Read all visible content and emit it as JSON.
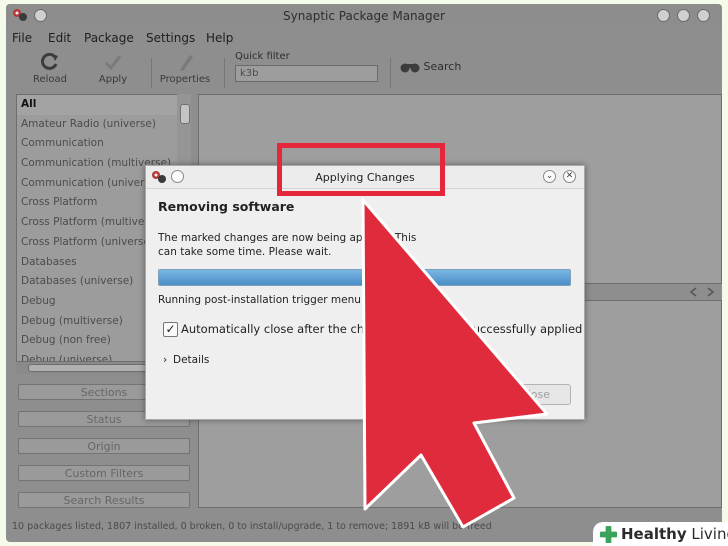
{
  "window": {
    "title": "Synaptic Package Manager"
  },
  "menu": [
    "File",
    "Edit",
    "Package",
    "Settings",
    "Help"
  ],
  "toolbar": {
    "reload": "Reload",
    "apply": "Apply",
    "properties": "Properties",
    "quick_filter_label": "Quick filter",
    "quick_filter_value": "k3b",
    "search": "Search"
  },
  "categories": [
    "All",
    "Amateur Radio (universe)",
    "Communication",
    "Communication (multiverse)",
    "Communication (universe)",
    "Cross Platform",
    "Cross Platform (multiverse)",
    "Cross Platform (universe)",
    "Databases",
    "Databases (universe)",
    "Debug",
    "Debug (multiverse)",
    "Debug (non free)",
    "Debug (universe)"
  ],
  "filter_buttons": [
    "Sections",
    "Status",
    "Origin",
    "Custom Filters",
    "Search Results"
  ],
  "status_bar": "10 packages listed, 1807 installed, 0 broken, 0 to install/upgrade, 1 to remove; 1891 kB will be freed",
  "dialog": {
    "title": "Applying Changes",
    "heading": "Removing software",
    "message": "The marked changes are now being applied. This can take some time. Please wait.",
    "progress": 1.0,
    "status": "Running post-installation trigger menu",
    "auto_close_label": "Automatically close after the changes have been successfully applied",
    "auto_close_checked": true,
    "details": "Details",
    "close": "Close"
  },
  "watermark": {
    "brand_bold": "Healthy",
    "brand_rest": "Living"
  },
  "colors": {
    "highlight": "#e6263a",
    "arrow": "#e02b3c",
    "progress": "#4a8ec8",
    "brand": "#3aa35b"
  }
}
